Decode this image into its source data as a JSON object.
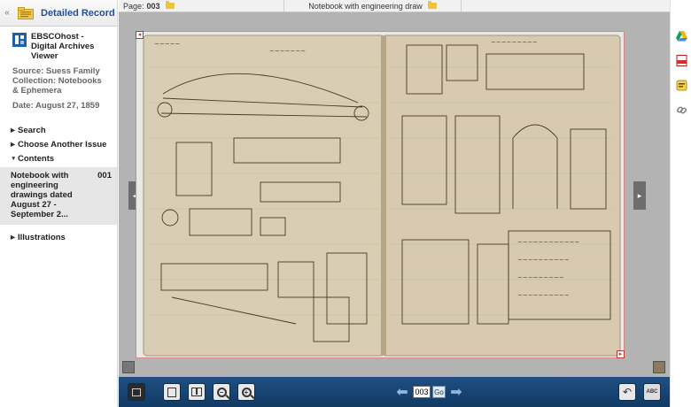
{
  "left_panel": {
    "collapse_glyph": "«",
    "header_title": "Detailed Record",
    "source_title": "EBSCOhost - Digital Archives Viewer",
    "source_line": "Source: Suess Family Collection: Notebooks & Ephemera",
    "date_line": "Date: August 27, 1859",
    "nav": {
      "search": "Search",
      "choose_issue": "Choose Another Issue",
      "contents": "Contents",
      "illustrations": "Illustrations"
    },
    "contents_entry": {
      "title": "Notebook with engineering drawings dated August 27 - September 2...",
      "number": "001"
    }
  },
  "viewer": {
    "page_label": "Page:",
    "page_number": "003",
    "doc_title": "Notebook with engineering draw",
    "page_input_value": "003",
    "go_label": "Go",
    "text_button": "ABC",
    "corner_glyph": "◂",
    "corner_glyph_br": "▸"
  },
  "icons": {
    "prev": "◂",
    "next": "▸",
    "nav_prev": "⬅",
    "nav_next": "➡",
    "back": "↶"
  },
  "colors": {
    "toolbar": "#1a4777",
    "page_border": "#d08989",
    "viewer_bg": "#b3b3b3",
    "header_link": "#1f4f9a"
  }
}
